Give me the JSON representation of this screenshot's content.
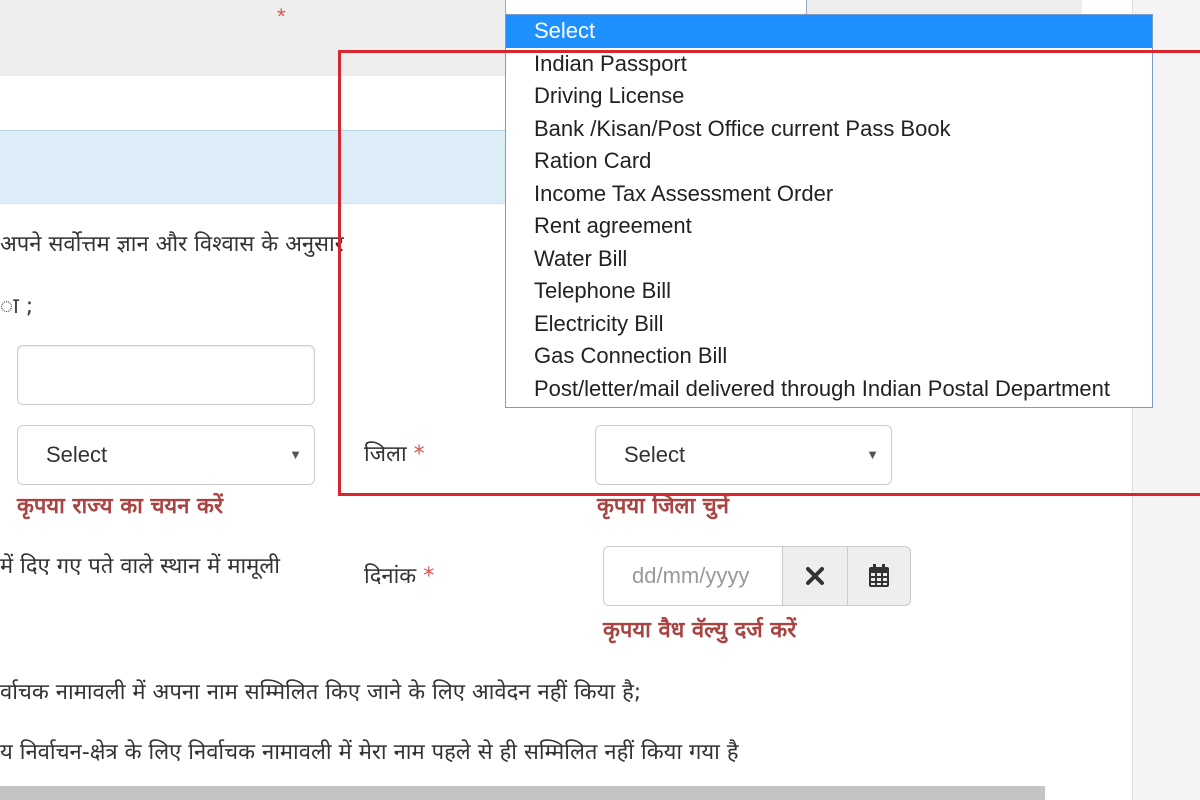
{
  "top": {
    "required_mark": "*"
  },
  "declaration": {
    "line1": "अपने सर्वोत्तम ज्ञान और विश्वास के अनुसार",
    "line2": "ा ;",
    "line3": "में दिए गए पते वाले स्थान में मामूली",
    "line4": "र्वाचक नामावली में अपना नाम सम्मिलित किए जाने के लिए आवेदन नहीं किया है;",
    "line5": "य निर्वाचन-क्षेत्र के लिए निर्वाचक नामावली में मेरा नाम पहले से ही सम्मिलित नहीं किया गया है"
  },
  "text_input": {
    "value": ""
  },
  "state": {
    "selected": "Select",
    "error": "कृपया राज्य का चयन करें"
  },
  "district": {
    "label": "जिला",
    "required_mark": "*",
    "selected": "Select",
    "error": "कृपया जिला चुनें"
  },
  "date": {
    "label": "दिनांक",
    "required_mark": "*",
    "placeholder": "dd/mm/yyyy",
    "error": "कृपया वैध वॅल्यु दर्ज करें",
    "clear_icon": "close-icon",
    "calendar_icon": "calendar-icon"
  },
  "document_dropdown": {
    "options": [
      "Select",
      "Indian Passport",
      "Driving License",
      "Bank /Kisan/Post Office current Pass Book",
      "Ration Card",
      "Income Tax Assessment Order",
      "Rent agreement",
      "Water Bill",
      "Telephone Bill",
      "Electricity Bill",
      "Gas Connection Bill",
      "Post/letter/mail delivered through Indian Postal Department"
    ],
    "highlighted_index": 0
  },
  "colors": {
    "highlight_border": "#d7262e",
    "dropdown_selected_bg": "#1e90ff",
    "error_text": "#a94442",
    "required": "#d9534f",
    "panel_header_bg": "#ddeef8"
  }
}
